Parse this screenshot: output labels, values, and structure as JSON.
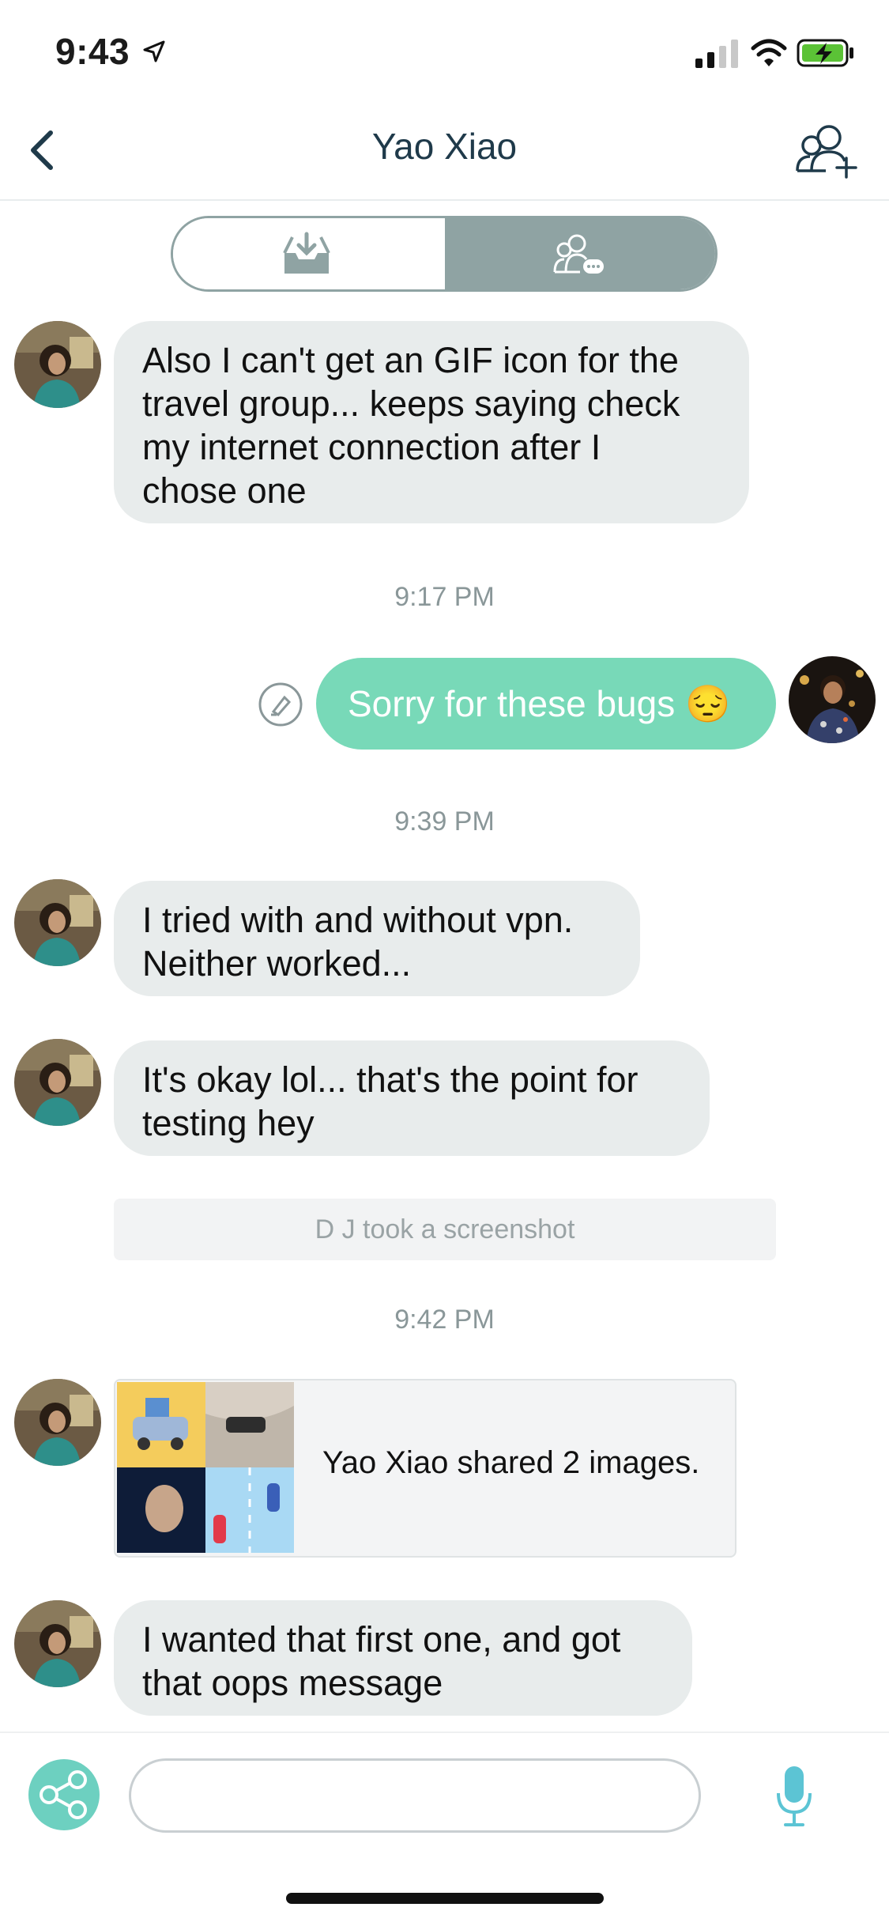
{
  "status_bar": {
    "time": "9:43",
    "icons": [
      "location-arrow-icon",
      "cellular-signal-icon",
      "wifi-icon",
      "battery-charging-icon"
    ]
  },
  "nav": {
    "title": "Yao Xiao",
    "back_icon": "chevron-left-icon",
    "add_member_icon": "add-person-icon"
  },
  "segments": [
    {
      "icon": "inbox-download-icon",
      "active": false
    },
    {
      "icon": "group-chat-icon",
      "active": true
    }
  ],
  "messages": {
    "m1": "Also I can't get an GIF icon for the travel group... keeps saying check my internet connection after I chose one",
    "m1_lines": [
      "Also I can't get an GIF icon for the",
      "travel group... keeps saying check",
      "my internet connection after I",
      "chose one"
    ],
    "t1": "9:17 PM",
    "me1": "Sorry for these bugs 😔",
    "t2": "9:39 PM",
    "m2_lines": [
      "I tried with and without vpn.",
      "Neither worked..."
    ],
    "m3_lines": [
      "It's okay lol... that's the point for",
      "testing hey"
    ],
    "system": "D J took a screenshot",
    "t3": "9:42 PM",
    "share": "Yao Xiao shared 2 images.",
    "m4_lines": [
      "I wanted that first one, and got",
      "that oops message"
    ]
  },
  "composer": {
    "value": "",
    "placeholder": "",
    "share_icon": "share-nodes-icon",
    "mic_icon": "microphone-icon"
  },
  "colors": {
    "accent": "#78d9b8",
    "bubble_gray": "#e8ecec",
    "segment_gray": "#8fa3a3",
    "nav_text": "#1f3a4a"
  }
}
